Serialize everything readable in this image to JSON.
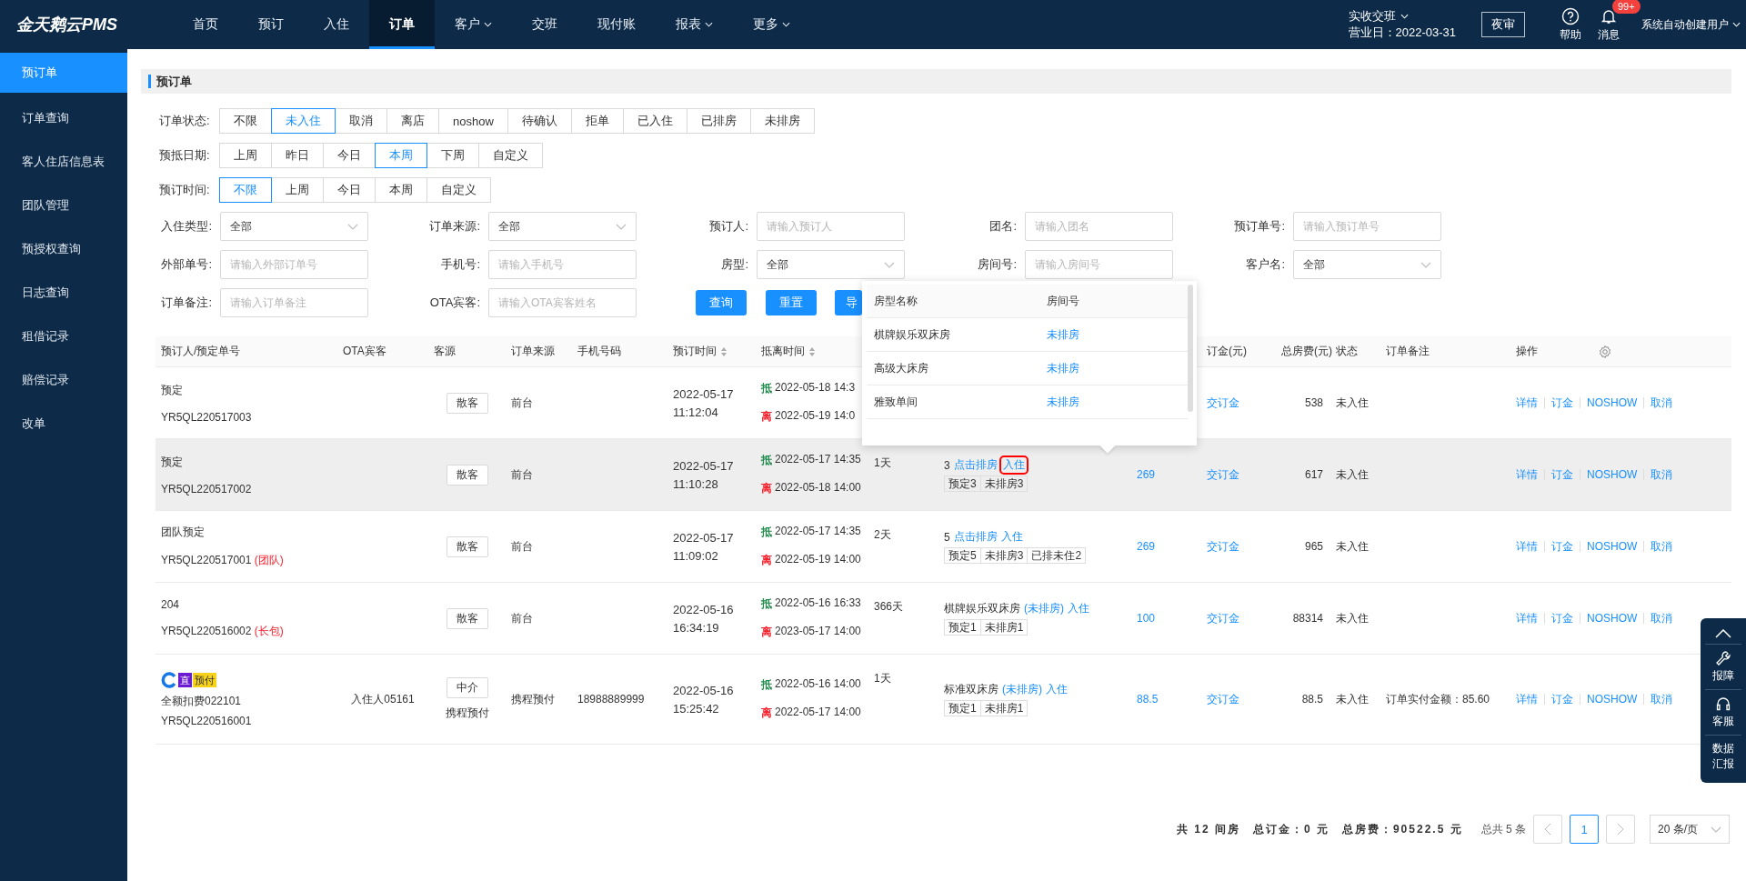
{
  "app": {
    "logo": "金天鹅云PMS"
  },
  "nav": [
    {
      "label": "首页",
      "selected": false,
      "dropdown": false
    },
    {
      "label": "预订",
      "selected": false,
      "dropdown": false
    },
    {
      "label": "入住",
      "selected": false,
      "dropdown": false
    },
    {
      "label": "订单",
      "selected": true,
      "dropdown": false
    },
    {
      "label": "客户",
      "selected": false,
      "dropdown": true
    },
    {
      "label": "交班",
      "selected": false,
      "dropdown": false
    },
    {
      "label": "现付账",
      "selected": false,
      "dropdown": false
    },
    {
      "label": "报表",
      "selected": false,
      "dropdown": true
    },
    {
      "label": "更多",
      "selected": false,
      "dropdown": true
    }
  ],
  "topbar": {
    "shift": "实收交班",
    "business_day": "营业日：2022-03-31",
    "night_audit": "夜审",
    "help": "帮助",
    "messages": "消息",
    "message_badge": "99+",
    "user": "系统自动创建用户"
  },
  "sidebar": [
    {
      "label": "预订单",
      "selected": true
    },
    {
      "label": "订单查询",
      "selected": false
    },
    {
      "label": "客人住店信息表",
      "selected": false
    },
    {
      "label": "团队管理",
      "selected": false
    },
    {
      "label": "预授权查询",
      "selected": false
    },
    {
      "label": "日志查询",
      "selected": false
    },
    {
      "label": "租借记录",
      "selected": false
    },
    {
      "label": "赔偿记录",
      "selected": false
    },
    {
      "label": "改单",
      "selected": false
    }
  ],
  "page_title": "预订单",
  "filter_groups": [
    {
      "label": "订单状态:",
      "options": [
        {
          "label": "不限",
          "selected": false
        },
        {
          "label": "未入住",
          "selected": true
        },
        {
          "label": "取消",
          "selected": false
        },
        {
          "label": "离店",
          "selected": false
        },
        {
          "label": "noshow",
          "selected": false
        },
        {
          "label": "待确认",
          "selected": false
        },
        {
          "label": "拒单",
          "selected": false
        },
        {
          "label": "已入住",
          "selected": false
        },
        {
          "label": "已排房",
          "selected": false
        },
        {
          "label": "未排房",
          "selected": false
        }
      ]
    },
    {
      "label": "预抵日期:",
      "options": [
        {
          "label": "上周",
          "selected": false
        },
        {
          "label": "昨日",
          "selected": false
        },
        {
          "label": "今日",
          "selected": false
        },
        {
          "label": "本周",
          "selected": true
        },
        {
          "label": "下周",
          "selected": false
        },
        {
          "label": "自定义",
          "selected": false
        }
      ]
    },
    {
      "label": "预订时间:",
      "options": [
        {
          "label": "不限",
          "selected": true
        },
        {
          "label": "上周",
          "selected": false
        },
        {
          "label": "今日",
          "selected": false
        },
        {
          "label": "本周",
          "selected": false
        },
        {
          "label": "自定义",
          "selected": false
        }
      ]
    }
  ],
  "form_fields": [
    {
      "label": "入住类型:",
      "kind": "select",
      "value": "全部"
    },
    {
      "label": "订单来源:",
      "kind": "select",
      "value": "全部"
    },
    {
      "label": "预订人:",
      "kind": "input",
      "placeholder": "请输入预订人"
    },
    {
      "label": "团名:",
      "kind": "input",
      "placeholder": "请输入团名"
    },
    {
      "label": "预订单号:",
      "kind": "input",
      "placeholder": "请输入预订单号"
    },
    {
      "label": "外部单号:",
      "kind": "input",
      "placeholder": "请输入外部订单号"
    },
    {
      "label": "手机号:",
      "kind": "input",
      "placeholder": "请输入手机号"
    },
    {
      "label": "房型:",
      "kind": "select",
      "value": "全部"
    },
    {
      "label": "房间号:",
      "kind": "input",
      "placeholder": "请输入房间号"
    },
    {
      "label": "客户名:",
      "kind": "select",
      "value": "全部"
    },
    {
      "label": "订单备注:",
      "kind": "input",
      "placeholder": "请输入订单备注"
    },
    {
      "label": "OTA宾客:",
      "kind": "input",
      "placeholder": "请输入OTA宾客姓名"
    }
  ],
  "form_buttons": [
    "查询",
    "重置",
    "导"
  ],
  "table": {
    "columns": [
      {
        "label": "预订人/预定单号",
        "sortable": false
      },
      {
        "label": "OTA宾客",
        "sortable": false
      },
      {
        "label": "客源",
        "sortable": false
      },
      {
        "label": "订单来源",
        "sortable": false
      },
      {
        "label": "手机号码",
        "sortable": false
      },
      {
        "label": "预订时间",
        "sortable": true
      },
      {
        "label": "抵离时间",
        "sortable": true
      }
    ],
    "columns_right": [
      {
        "label": "订金(元)"
      },
      {
        "label": "总房费(元)"
      },
      {
        "label": "状态"
      },
      {
        "label": "订单备注"
      },
      {
        "label": "操作"
      }
    ],
    "rows": [
      {
        "hovered": false,
        "booker": "预定",
        "order_no": "YR5QL220517003",
        "source": "散客",
        "order_source": "前台",
        "book_date": "2022-05-17",
        "book_time": "11:12:04",
        "stay": [
          {
            "kind": "arrive",
            "label": "抵",
            "time": "2022-05-18 14:3"
          },
          {
            "kind": "leave",
            "label": "离",
            "time": "2022-05-19 14:0"
          }
        ],
        "deposit": "交订金",
        "total": "538",
        "status": "未入住",
        "actions": [
          "详情",
          "订金",
          "NOSHOW",
          "取消"
        ]
      },
      {
        "hovered": true,
        "booker": "预定",
        "order_no": "YR5QL220517002",
        "source": "散客",
        "order_source": "前台",
        "book_date": "2022-05-17",
        "book_time": "11:10:28",
        "stay": [
          {
            "kind": "arrive",
            "label": "抵",
            "time": "2022-05-17 14:35"
          },
          {
            "kind": "leave",
            "label": "离",
            "time": "2022-05-18 14:00"
          }
        ],
        "nights": "1天",
        "room": {
          "kind": "count",
          "count": "3",
          "assign": "点击排房",
          "checkin": "入住",
          "checkin_marked": true,
          "tags": [
            "预定3",
            "未排房3"
          ]
        },
        "price": "269",
        "deposit": "交订金",
        "total": "617",
        "status": "未入住",
        "actions": [
          "详情",
          "订金",
          "NOSHOW",
          "取消"
        ]
      },
      {
        "hovered": false,
        "booker": "团队预定",
        "order_no": "YR5QL220517001",
        "order_tag": "(团队)",
        "source": "散客",
        "order_source": "前台",
        "book_date": "2022-05-17",
        "book_time": "11:09:02",
        "stay": [
          {
            "kind": "arrive",
            "label": "抵",
            "time": "2022-05-17 14:35"
          },
          {
            "kind": "leave",
            "label": "离",
            "time": "2022-05-19 14:00"
          }
        ],
        "nights": "2天",
        "room": {
          "kind": "count",
          "count": "5",
          "assign": "点击排房",
          "checkin": "入住",
          "checkin_marked": false,
          "tags": [
            "预定5",
            "未排房3",
            "已排未住2"
          ]
        },
        "price": "269",
        "deposit": "交订金",
        "total": "965",
        "status": "未入住",
        "actions": [
          "详情",
          "订金",
          "NOSHOW",
          "取消"
        ]
      },
      {
        "hovered": false,
        "booker": "204",
        "order_no": "YR5QL220516002",
        "order_tag": "(长包)",
        "source": "散客",
        "order_source": "前台",
        "book_date": "2022-05-16",
        "book_time": "16:34:19",
        "stay": [
          {
            "kind": "arrive",
            "label": "抵",
            "time": "2022-05-16 16:33"
          },
          {
            "kind": "leave",
            "label": "离",
            "time": "2023-05-17 14:00"
          }
        ],
        "nights": "366天",
        "room": {
          "kind": "named",
          "type": "棋牌娱乐双床房",
          "assign": "(未排房)",
          "checkin": "入住",
          "checkin_marked": false,
          "tags": [
            "预定1",
            "未排房1"
          ]
        },
        "price": "100",
        "deposit": "交订金",
        "total": "88314",
        "status": "未入住",
        "actions": [
          "详情",
          "订金",
          "NOSHOW",
          "取消"
        ]
      },
      {
        "hovered": false,
        "badges": [
          "直",
          "预付"
        ],
        "booker": "全额扣费022101",
        "order_no": "YR5QL220516001",
        "ota_guest": "入住人05161",
        "source": "中介",
        "source_sub": "携程预付",
        "order_source": "携程预付",
        "phone": "18988889999",
        "book_date": "2022-05-16",
        "book_time": "15:25:42",
        "stay": [
          {
            "kind": "arrive",
            "label": "抵",
            "time": "2022-05-16 14:00"
          },
          {
            "kind": "leave",
            "label": "离",
            "time": "2022-05-17 14:00"
          }
        ],
        "nights": "1天",
        "room": {
          "kind": "named",
          "type": "标准双床房",
          "assign": "(未排房)",
          "checkin": "入住",
          "checkin_marked": false,
          "tags": [
            "预定1",
            "未排房1"
          ]
        },
        "price": "88.5",
        "deposit": "交订金",
        "total": "88.5",
        "status": "未入住",
        "note": "订单实付金额：85.60",
        "actions": [
          "详情",
          "订金",
          "NOSHOW",
          "取消"
        ]
      }
    ]
  },
  "room_popup": {
    "columns": [
      "房型名称",
      "房间号"
    ],
    "rows": [
      {
        "room_type": "棋牌娱乐双床房",
        "room_no": "未排房"
      },
      {
        "room_type": "高级大床房",
        "room_no": "未排房"
      },
      {
        "room_type": "雅致单间",
        "room_no": "未排房"
      }
    ]
  },
  "summary": {
    "rooms": "共 12 间房",
    "deposit": "总订金：0 元",
    "room_fee": "总房费：90522.5 元"
  },
  "pagination": {
    "total": "总共 5 条",
    "pages": [
      {
        "label": "1",
        "selected": true
      }
    ],
    "page_size": "20 条/页"
  },
  "float_panel": [
    {
      "kind": "top"
    },
    {
      "kind": "repair",
      "label": "报障"
    },
    {
      "kind": "service",
      "label": "客服"
    },
    {
      "kind": "report",
      "label": "数据汇报"
    }
  ]
}
